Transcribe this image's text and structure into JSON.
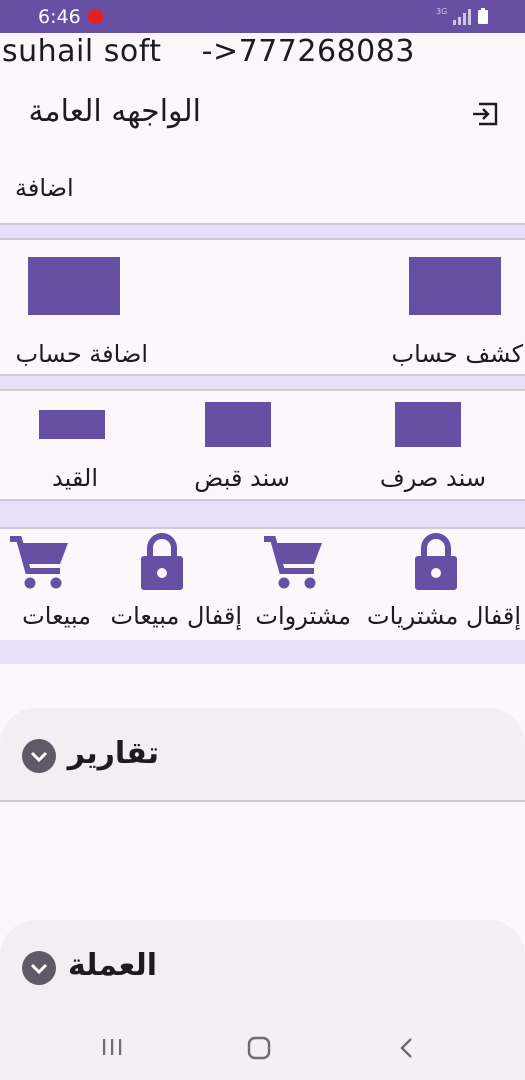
{
  "status_bar": {
    "time": "6:46",
    "network": "3G",
    "colors": {
      "bar": "#6750a4",
      "record_dot": "#e52020"
    }
  },
  "brand_line": "suhail soft    ->777268083",
  "header": {
    "title": "الواجهه العامة",
    "logout_icon": "logout-icon"
  },
  "add_link": "اضافة",
  "tiles_row1": [
    {
      "label": "كشف حساب",
      "icon": "purple-square-icon"
    },
    {
      "label": "اضافة حساب",
      "icon": "purple-square-icon"
    }
  ],
  "tiles_row2": [
    {
      "label": "سند صرف",
      "icon": "purple-square-icon"
    },
    {
      "label": "سند قبض",
      "icon": "purple-square-icon"
    },
    {
      "label": "القيد",
      "icon": "purple-square-icon"
    }
  ],
  "tiles_row3": [
    {
      "label": "إقفال مشتريات",
      "icon": "lock-icon"
    },
    {
      "label": "مشتروات",
      "icon": "cart-icon"
    },
    {
      "label": "إقفال مبيعات",
      "icon": "lock-icon"
    },
    {
      "label": "مبيعات",
      "icon": "cart-icon"
    }
  ],
  "panels": [
    {
      "title": "تقارير",
      "icon": "chevron-down-icon"
    },
    {
      "title": "العملة",
      "icon": "chevron-down-icon"
    }
  ],
  "nav_bar": {
    "icons": [
      "recent-apps-icon",
      "home-icon",
      "back-icon"
    ]
  },
  "theme": {
    "primary": "#6750a4",
    "band": "#e8def8",
    "background": "#fdf7fc"
  }
}
